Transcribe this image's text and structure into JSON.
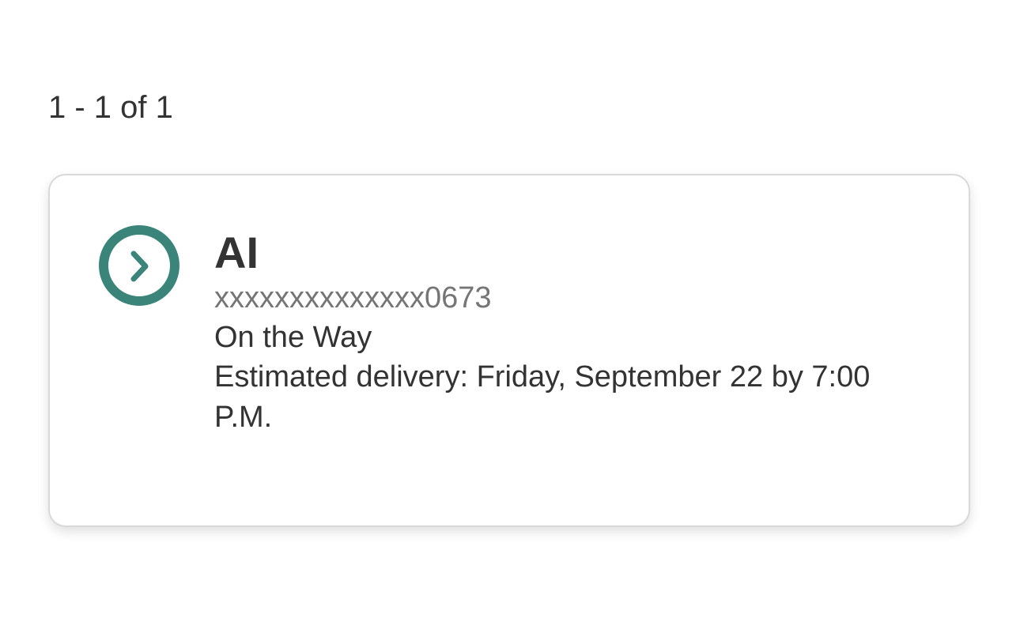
{
  "pagination": {
    "range_text": "1 - 1 of 1"
  },
  "shipments": [
    {
      "recipient": "AI",
      "tracking_number": "xxxxxxxxxxxxxx0673",
      "status": "On the Way",
      "estimated_delivery": "Estimated delivery: Friday, September 22 by 7:00 P.M.",
      "status_icon": "chevron-right-circle-icon"
    }
  ],
  "colors": {
    "accent": "#3a847a",
    "text_primary": "#333333",
    "text_secondary": "#757575",
    "card_border": "#d9d9d9"
  }
}
